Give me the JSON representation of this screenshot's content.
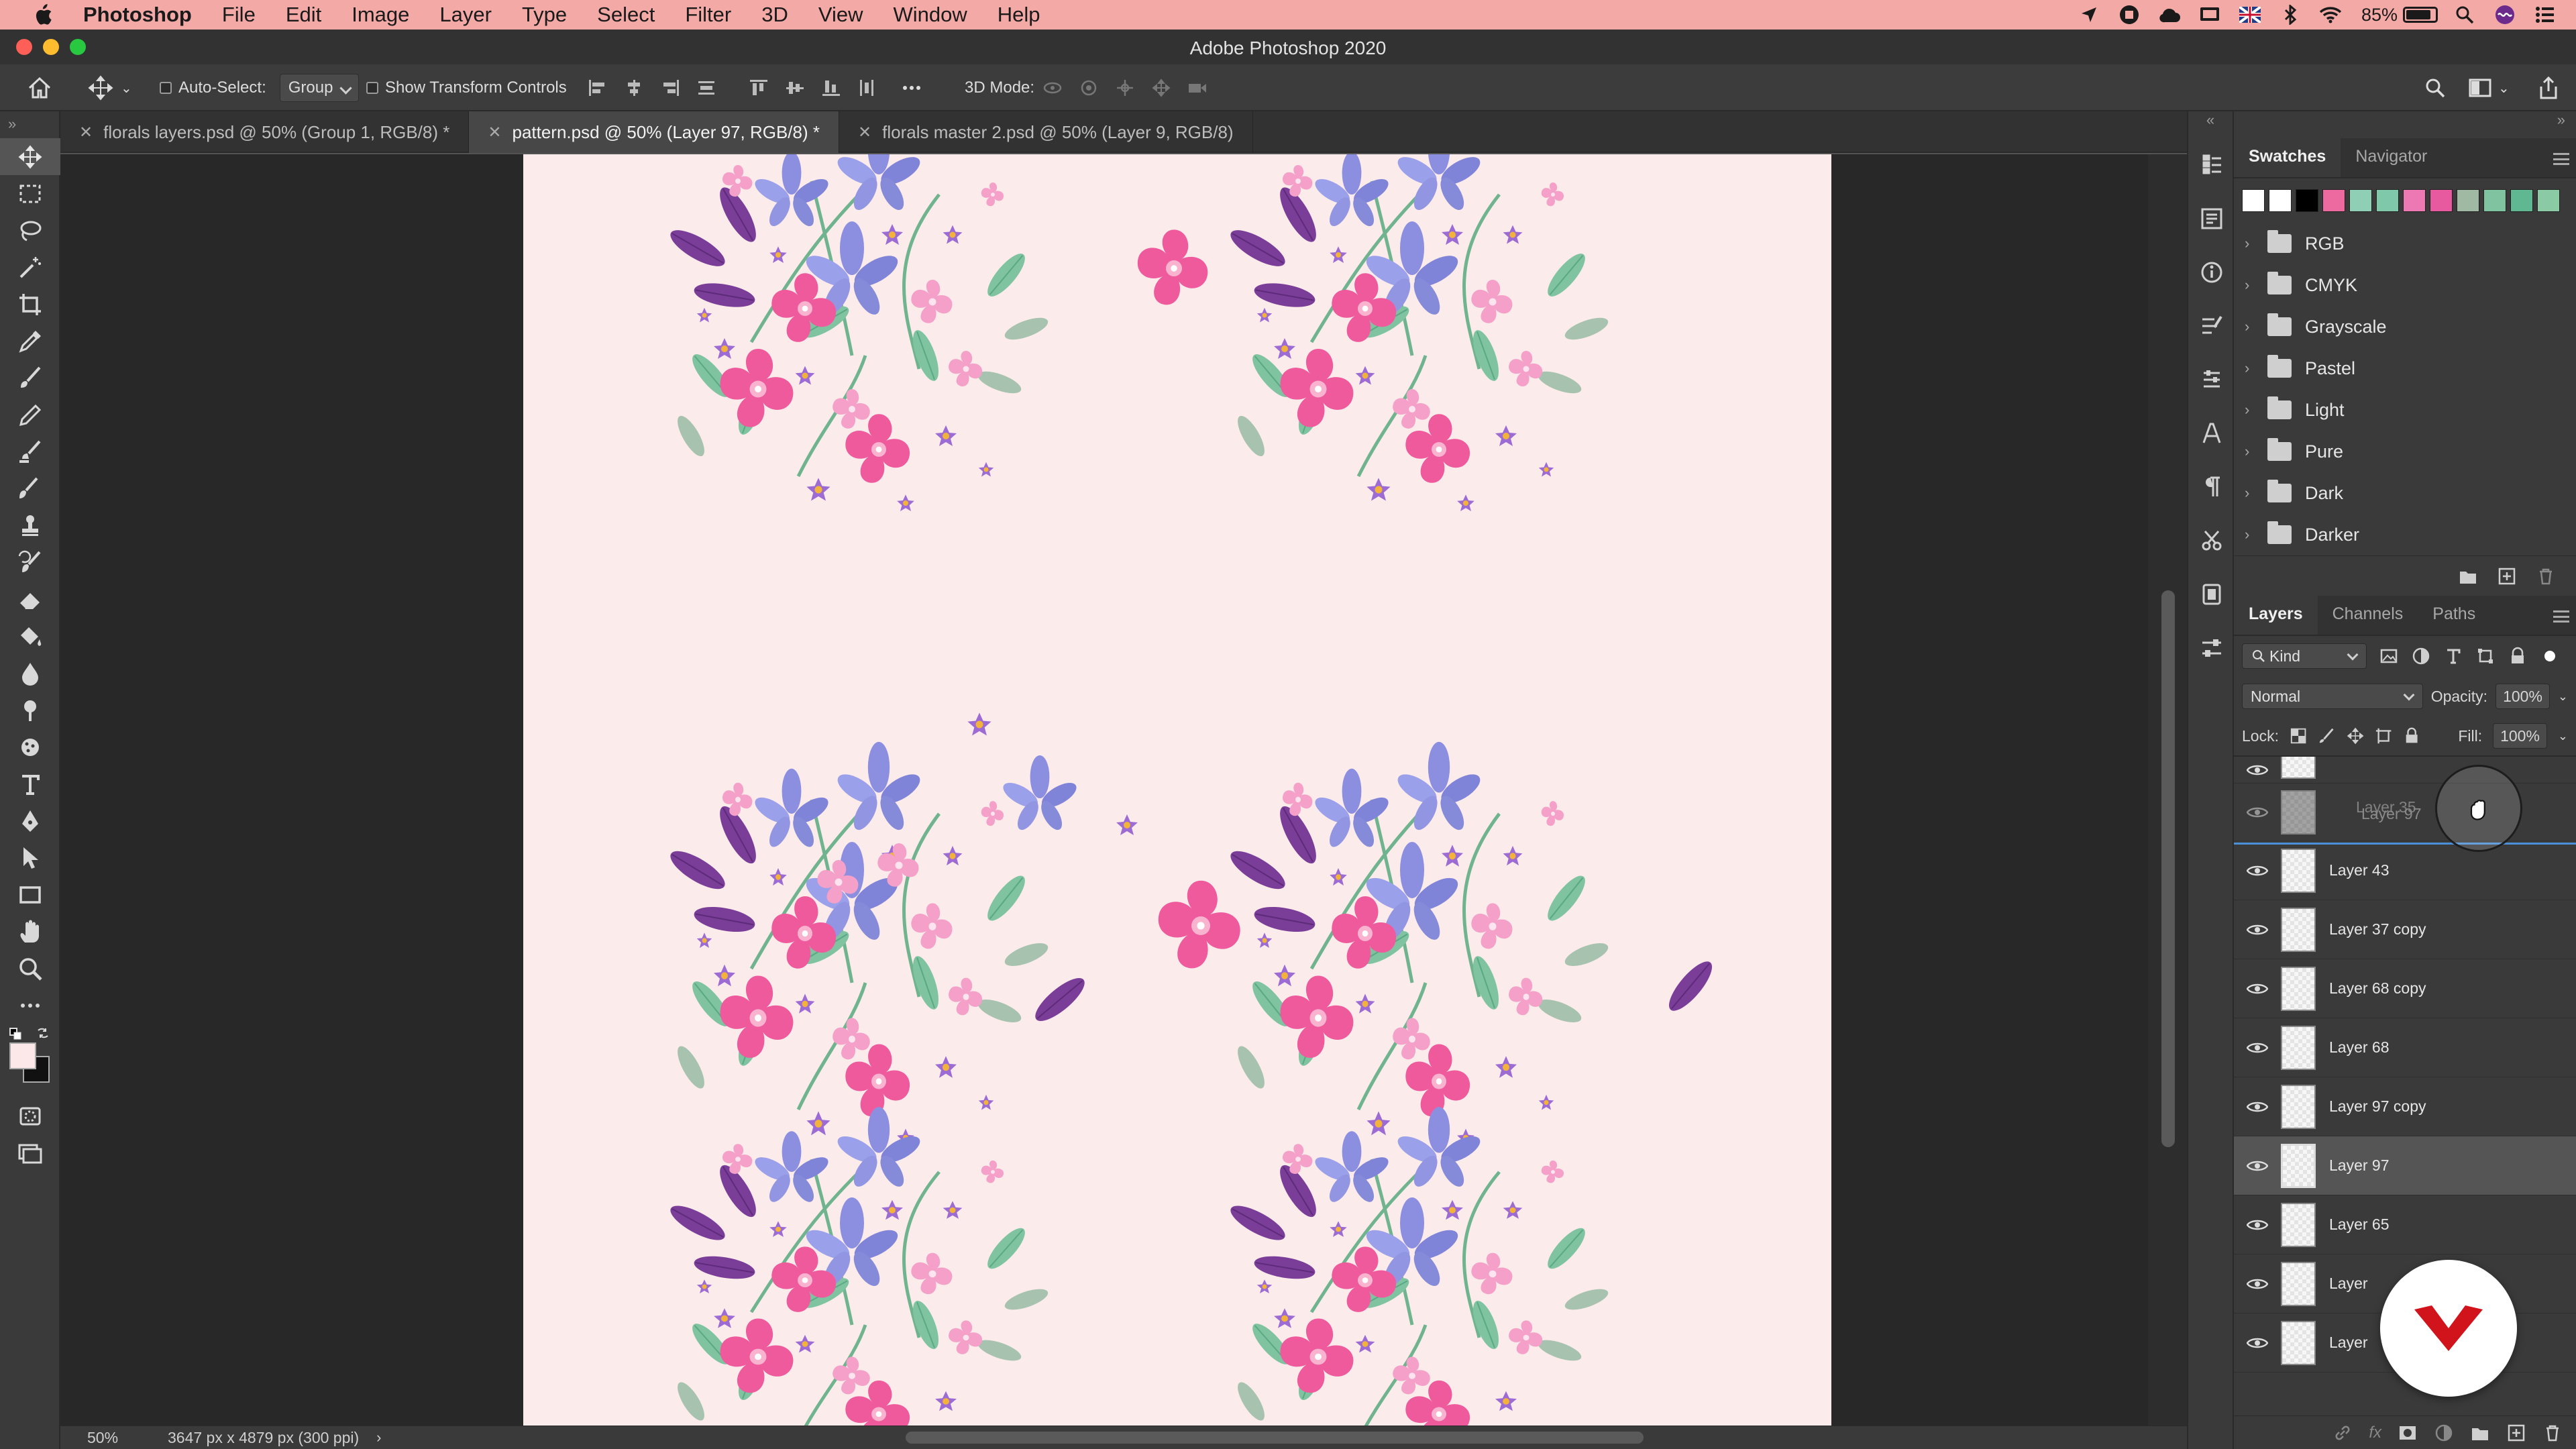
{
  "menubar": {
    "app_name": "Photoshop",
    "items": [
      "File",
      "Edit",
      "Image",
      "Layer",
      "Type",
      "Select",
      "Filter",
      "3D",
      "View",
      "Window",
      "Help"
    ],
    "battery": "85%"
  },
  "window": {
    "title": "Adobe Photoshop 2020"
  },
  "options_bar": {
    "auto_select_label": "Auto-Select:",
    "auto_select_value": "Group",
    "transform_controls_label": "Show Transform Controls",
    "mode_3d_label": "3D Mode:"
  },
  "tabs": [
    {
      "label": "florals layers.psd @ 50% (Group 1, RGB/8) *",
      "active": false
    },
    {
      "label": "pattern.psd @ 50% (Layer 97, RGB/8) *",
      "active": true
    },
    {
      "label": "florals master 2.psd @ 50% (Layer 9, RGB/8)",
      "active": false
    }
  ],
  "status": {
    "zoom": "50%",
    "doc_info": "3647 px x 4879 px (300 ppi)"
  },
  "swatches_panel": {
    "tabs": [
      "Swatches",
      "Navigator"
    ],
    "colors": [
      "#ffffff",
      "#ffffff",
      "#000000",
      "#ec6aa0",
      "#8fcfb5",
      "#7fc8a9",
      "#ec79b4",
      "#e85a9f",
      "#9fb9a3",
      "#7fc3a1",
      "#5fb891",
      "#8acaa5"
    ],
    "folders": [
      "RGB",
      "CMYK",
      "Grayscale",
      "Pastel",
      "Light",
      "Pure",
      "Dark",
      "Darker"
    ]
  },
  "layers_panel": {
    "tabs": [
      "Layers",
      "Channels",
      "Paths"
    ],
    "kind_label": "Kind",
    "blend_mode": "Normal",
    "opacity_label": "Opacity:",
    "opacity_value": "100%",
    "lock_label": "Lock:",
    "fill_label": "Fill:",
    "fill_value": "100%",
    "dragging_ghost_labels": [
      "Layer 35",
      "Layer 97"
    ],
    "layers": [
      {
        "name": "Layer 43",
        "selected": false
      },
      {
        "name": "Layer 37 copy",
        "selected": false
      },
      {
        "name": "Layer 68 copy",
        "selected": false
      },
      {
        "name": "Layer 68",
        "selected": false
      },
      {
        "name": "Layer 97 copy",
        "selected": false
      },
      {
        "name": "Layer 97",
        "selected": true
      },
      {
        "name": "Layer 65",
        "selected": false
      },
      {
        "name": "Layer",
        "selected": false
      },
      {
        "name": "Layer",
        "selected": false
      }
    ]
  },
  "colors": {
    "menubar_bg": "#f3a9a6",
    "document_bg": "#fcebeb",
    "accent_blue": "#4a90d9",
    "badge_red": "#d1131c"
  },
  "icons": {
    "toolbar": [
      "move-icon",
      "marquee-icon",
      "lasso-icon",
      "magic-wand-icon",
      "crop-icon",
      "eyedropper-icon",
      "brush-icon",
      "pencil-icon",
      "mixer-brush-icon",
      "healing-brush-icon",
      "clone-stamp-icon",
      "history-brush-icon",
      "eraser-icon",
      "paint-bucket-icon",
      "blur-icon",
      "dodge-icon",
      "sponge-icon",
      "type-icon",
      "pen-icon",
      "path-selection-icon",
      "rectangle-icon",
      "hand-icon",
      "zoom-icon",
      "more-tools-icon"
    ]
  }
}
